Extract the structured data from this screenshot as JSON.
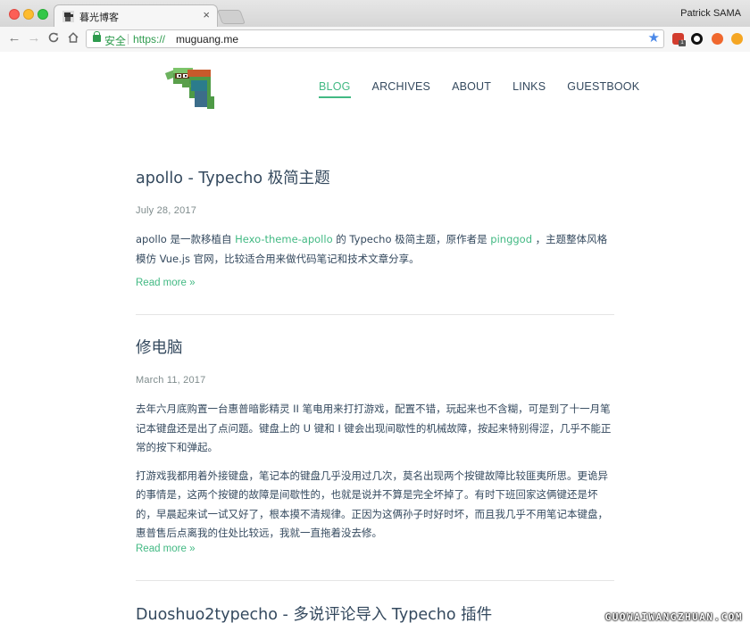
{
  "browser": {
    "tab_title": "暮光博客",
    "tab_close": "×",
    "profile_name": "Patrick SAMA",
    "secure_label": "安全",
    "url_scheme": "https://",
    "url_host": "muguang.me",
    "ext_badge": "1",
    "colors": {
      "secure_green": "#2e9b4e",
      "star_blue": "#4a88e8"
    }
  },
  "site": {
    "nav": [
      {
        "label": "BLOG",
        "active": true
      },
      {
        "label": "ARCHIVES",
        "active": false
      },
      {
        "label": "ABOUT",
        "active": false
      },
      {
        "label": "LINKS",
        "active": false
      },
      {
        "label": "GUESTBOOK",
        "active": false
      }
    ],
    "accent_color": "#42b983",
    "text_color": "#34495e"
  },
  "posts": [
    {
      "title": "apollo - Typecho 极简主题",
      "date": "July 28, 2017",
      "body": {
        "t1": "apollo 是一款移植自 ",
        "link1": "Hexo-theme-apollo",
        "t2": " 的 Typecho 极简主题，原作者是 ",
        "link2": "pinggod",
        "t3": " ，主题整体风格模仿 Vue.js 官网，比较适合用来做代码笔记和技术文章分享。"
      },
      "more": "Read more »"
    },
    {
      "title": "修电脑",
      "date": "March 11, 2017",
      "paragraphs": [
        "去年六月底购置一台惠普暗影精灵 II 笔电用来打打游戏，配置不错，玩起来也不含糊，可是到了十一月笔记本键盘还是出了点问题。键盘上的 U 键和 I 键会出现间歇性的机械故障，按起来特别得涩，几乎不能正常的按下和弹起。",
        "打游戏我都用着外接键盘，笔记本的键盘几乎没用过几次，莫名出现两个按键故障比较匪夷所思。更诡异的事情是，这两个按键的故障是间歇性的，也就是说并不算是完全坏掉了。有时下班回家这俩键还是坏的，早晨起来试一试又好了，根本摸不清规律。正因为这俩孙子时好时坏，而且我几乎不用笔记本键盘，惠普售后点离我的住处比较远，我就一直拖着没去修。"
      ],
      "more": "Read more »"
    },
    {
      "title": "Duoshuo2typecho - 多说评论导入 Typecho 插件"
    }
  ],
  "watermark": "GUOWAIWANGZHUAN.COM"
}
